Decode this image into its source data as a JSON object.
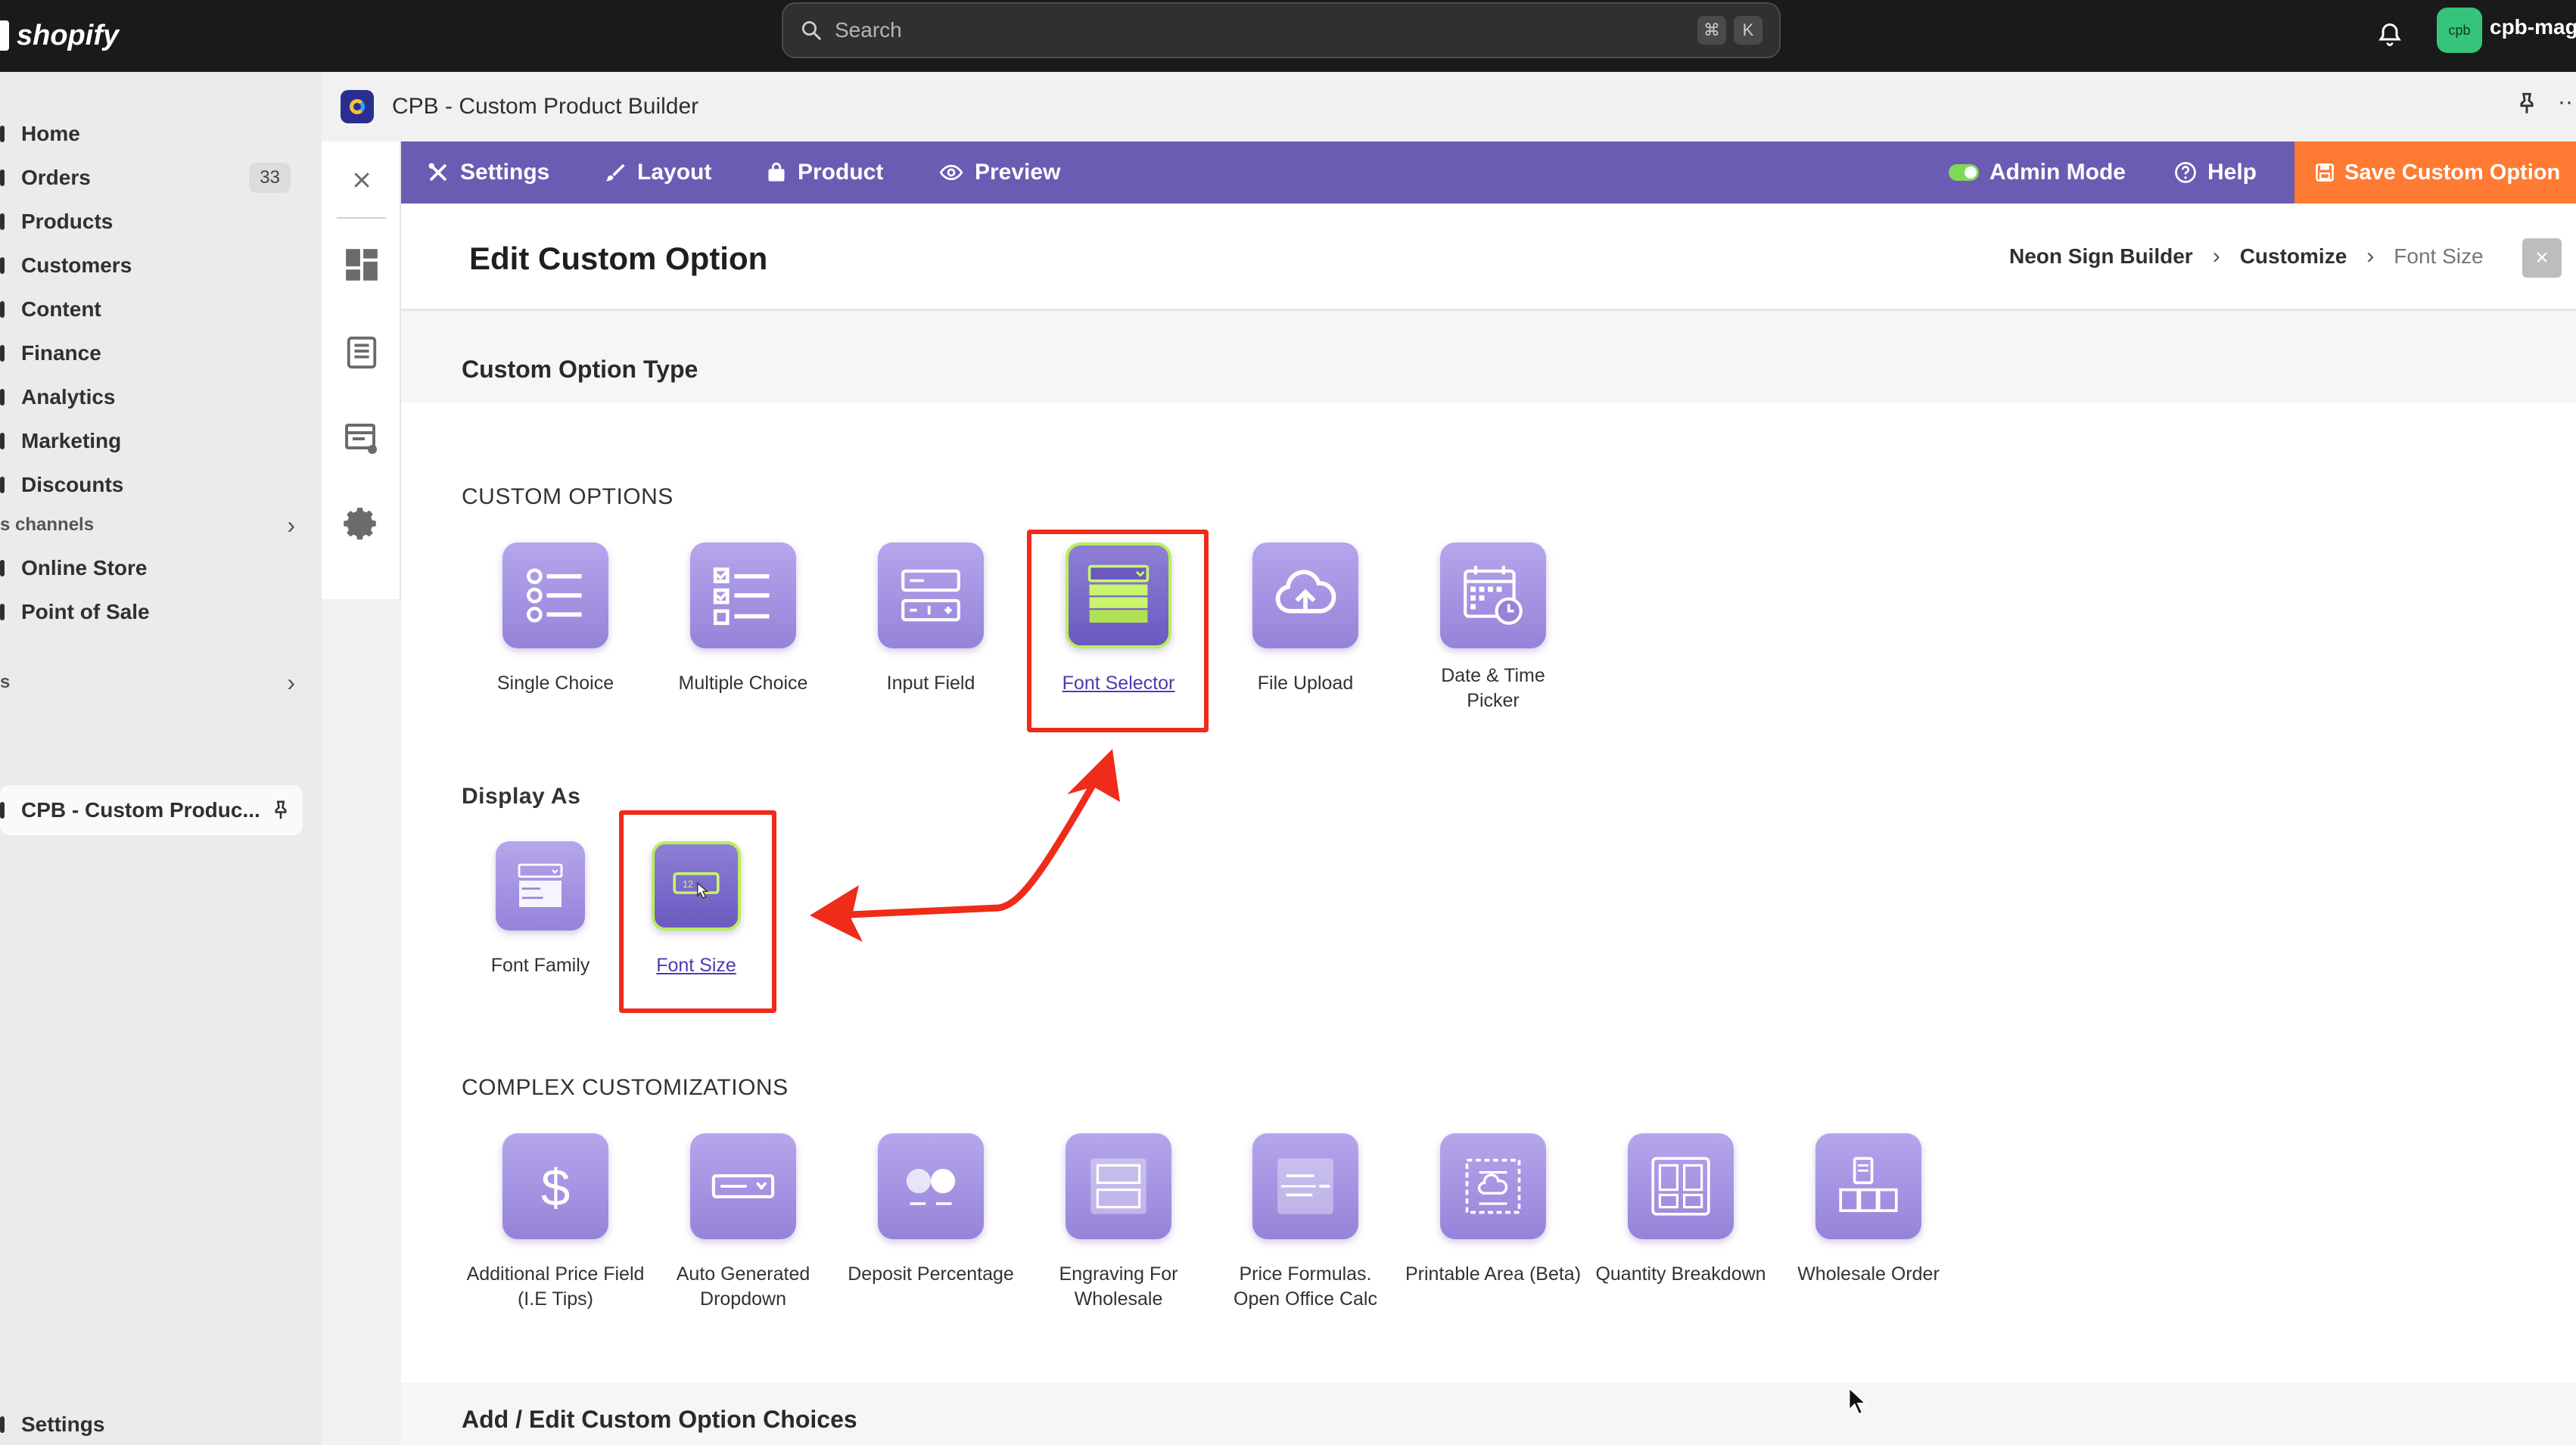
{
  "topbar": {
    "logo_text": "shopify",
    "search_placeholder": "Search",
    "shortcut_keys": [
      "⌘",
      "K"
    ],
    "avatar_text": "cpb",
    "store_name": "cpb-magc"
  },
  "nav": {
    "items": [
      {
        "label": "Home"
      },
      {
        "label": "Orders",
        "badge": "33"
      },
      {
        "label": "Products"
      },
      {
        "label": "Customers"
      },
      {
        "label": "Content"
      },
      {
        "label": "Finance"
      },
      {
        "label": "Analytics"
      },
      {
        "label": "Marketing"
      },
      {
        "label": "Discounts"
      }
    ],
    "sales_channels_label": "s channels",
    "channels": [
      {
        "label": "Online Store"
      },
      {
        "label": "Point of Sale"
      }
    ],
    "apps_label": "s",
    "active_app": "CPB - Custom Produc...",
    "settings": "Settings"
  },
  "app_header": {
    "title": "CPB - Custom Product Builder"
  },
  "toolbar": {
    "settings": "Settings",
    "layout": "Layout",
    "product": "Product",
    "preview": "Preview",
    "admin_mode": "Admin Mode",
    "help": "Help",
    "save": "Save Custom Option"
  },
  "page": {
    "title": "Edit Custom Option",
    "breadcrumb": [
      "Neon Sign Builder",
      "Customize",
      "Font Size"
    ],
    "close_glyph": "×",
    "section_title": "Custom Option Type",
    "bottom_section_title": "Add / Edit Custom Option Choices"
  },
  "custom_options": {
    "label": "CUSTOM OPTIONS",
    "tiles": [
      {
        "label": "Single Choice",
        "icon": "single-choice-icon"
      },
      {
        "label": "Multiple Choice",
        "icon": "multiple-choice-icon"
      },
      {
        "label": "Input Field",
        "icon": "input-field-icon"
      },
      {
        "label": "Font Selector",
        "icon": "font-selector-icon",
        "selected": true
      },
      {
        "label": "File Upload",
        "icon": "cloud-upload-icon"
      },
      {
        "label": "Date & Time Picker",
        "icon": "calendar-icon"
      }
    ]
  },
  "display_as": {
    "label": "Display As",
    "tiles": [
      {
        "label": "Font Family",
        "icon": "font-family-icon"
      },
      {
        "label": "Font Size",
        "icon": "font-size-icon",
        "selected": true
      }
    ]
  },
  "complex": {
    "label": "COMPLEX CUSTOMIZATIONS",
    "tiles": [
      {
        "label": "Additional Price Field (I.E Tips)",
        "icon": "dollar-icon"
      },
      {
        "label": "Auto Generated Dropdown",
        "icon": "dropdown-icon"
      },
      {
        "label": "Deposit Percentage",
        "icon": "percentage-icon"
      },
      {
        "label": "Engraving For Wholesale",
        "icon": "engraving-icon"
      },
      {
        "label": "Price Formulas. Open Office Calc",
        "icon": "formula-icon"
      },
      {
        "label": "Printable Area (Beta)",
        "icon": "printable-area-icon"
      },
      {
        "label": "Quantity Breakdown",
        "icon": "quantity-breakdown-icon"
      },
      {
        "label": "Wholesale Order",
        "icon": "wholesale-icon"
      }
    ]
  },
  "colors": {
    "toolbar": "#6c5bb3",
    "save_button": "#ff7a32",
    "annotation": "#ef2b19",
    "selected_border": "#b8ef5a"
  }
}
